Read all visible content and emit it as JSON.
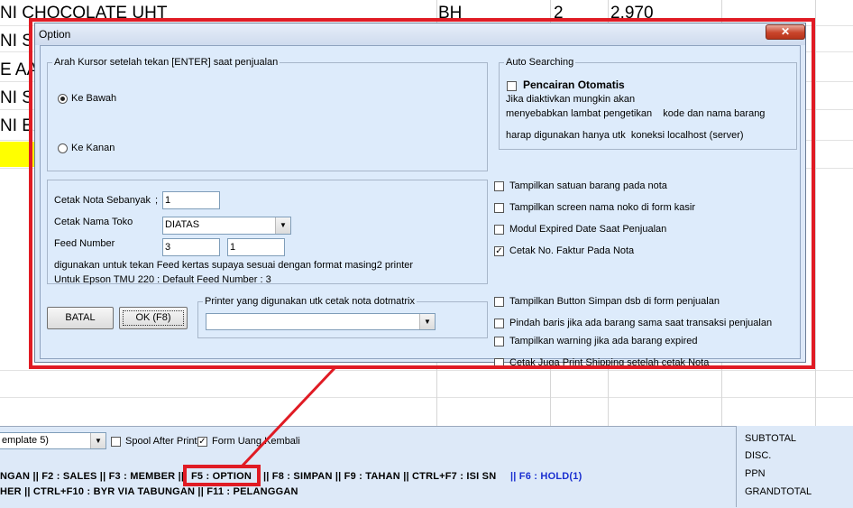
{
  "background": {
    "rows": [
      {
        "left": "NI CHOCOLATE UHT",
        "unit": "BH",
        "qty": "2",
        "price": "2.970"
      },
      {
        "left": "NI SE"
      },
      {
        "left": "E AA"
      },
      {
        "left": "NI SE"
      },
      {
        "left": "NI EX"
      }
    ]
  },
  "dialog": {
    "title": "Option",
    "close_glyph": "✕",
    "cursor_group": {
      "legend": "Arah Kursor setelah tekan [ENTER] saat penjualan",
      "option_down": "Ke Bawah",
      "option_right": "Ke Kanan"
    },
    "print_group": {
      "copies_label": "Cetak Nota Sebanyak",
      "copies_sep": ";",
      "copies_value": "1",
      "store_name_label": "Cetak Nama Toko",
      "store_name_value": "DIATAS",
      "feed_label": "Feed Number",
      "feed_value_1": "3",
      "feed_value_2": "1",
      "note_1": "digunakan untuk tekan Feed kertas supaya sesuai dengan format masing2 printer",
      "note_2": "Untuk Epson TMU 220 : Default Feed Number : 3"
    },
    "buttons": {
      "cancel": "BATAL",
      "ok": "OK (F8)"
    },
    "printer_group": {
      "legend": "Printer yang digunakan utk cetak nota dotmatrix",
      "value": ""
    },
    "auto_search": {
      "legend": "Auto Searching",
      "checkbox_label": "Pencairan Otomatis",
      "desc_1": "Jika diaktivkan mungkin akan",
      "desc_2": "menyebabkan lambat pengetikan    kode dan nama barang",
      "desc_3": "harap digunakan hanya utk  koneksi localhost (server)"
    },
    "options": [
      {
        "label": "Tampilkan satuan barang pada nota",
        "checked": ""
      },
      {
        "label": "Tampilkan screen nama noko di form kasir",
        "checked": ""
      },
      {
        "label": "Modul Expired Date Saat Penjualan",
        "checked": ""
      },
      {
        "label": "Cetak No. Faktur Pada Nota",
        "checked": "✓"
      },
      {
        "label": "Tampilkan Button Simpan dsb di form penjualan",
        "checked": ""
      },
      {
        "label": "Pindah baris jika ada barang sama saat transaksi penjualan",
        "checked": ""
      },
      {
        "label": "Tampilkan warning jika ada barang expired",
        "checked": ""
      },
      {
        "label": "Cetak Juga Print Shipping setelah cetak Nota",
        "checked": ""
      }
    ]
  },
  "bottom": {
    "template_value": "emplate 5)",
    "spool_label": "Spool After Print",
    "form_uang_label": "Form Uang Kembali",
    "form_uang_checked": "✓",
    "shortcuts_1a": "NGAN || F2 : SALES || F3 : MEMBER ||",
    "shortcut_option": "F5 : OPTION",
    "shortcuts_1b": "|| F8 : SIMPAN || F9 : TAHAN || CTRL+F7 : ISI SN",
    "shortcuts_1c": "|| F6 : HOLD(1)",
    "shortcuts_2": "HER || CTRL+F10 : BYR VIA TABUNGAN || F11 : PELANGGAN",
    "totals": [
      "SUBTOTAL",
      "DISC.",
      "PPN",
      "GRANDTOTAL"
    ]
  },
  "colors": {
    "annotation": "#e01b24",
    "dialog_bg": "#ddebfb",
    "hold_text": "#1a2fd0",
    "highlight_row": "#ffff00"
  }
}
